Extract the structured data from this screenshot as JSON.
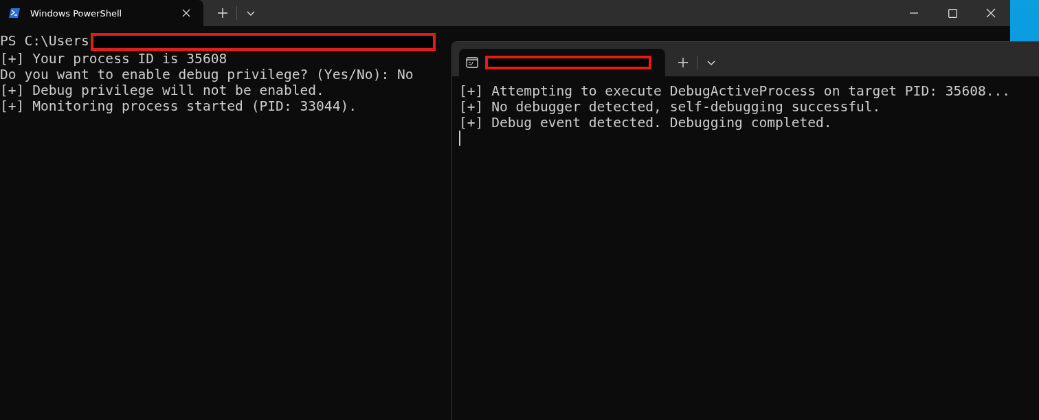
{
  "main_window": {
    "tab": {
      "title": "Windows PowerShell",
      "selected": true
    },
    "console": {
      "prompt": "PS C:\\Users",
      "lines": [
        "[+] Your process ID is 35608",
        "Do you want to enable debug privilege? (Yes/No): No",
        "[+] Debug privilege will not be enabled.",
        "[+] Monitoring process started (PID: 33044)."
      ]
    }
  },
  "second_window": {
    "tab": {
      "selected": true
    },
    "console": {
      "lines": [
        "[+] Attempting to execute DebugActiveProcess on target PID: 35608...",
        "[+] No debugger detected, self-debugging successful.",
        "[+] Debug event detected. Debugging completed."
      ]
    }
  }
}
